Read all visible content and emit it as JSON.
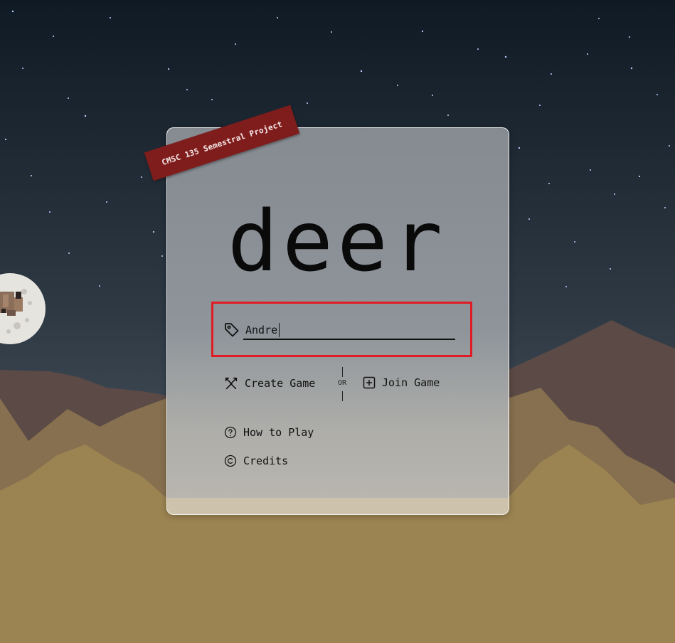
{
  "ribbon": {
    "text": "CMSC 135 Semestral Project"
  },
  "logo": {
    "title": "deer"
  },
  "name_field": {
    "value": "Andre"
  },
  "actions": {
    "create_label": "Create Game",
    "or_label": "OR",
    "join_label": "Join Game",
    "how_to_play_label": "How to Play",
    "credits_label": "Credits"
  },
  "colors": {
    "sky_top": "#0f1a24",
    "sky_bottom": "#5e6670",
    "mountain_back": "#5b4a45",
    "mountain_mid": "#86704f",
    "ground": "#9c8452",
    "ribbon": "#7f1d1d",
    "highlight": "#e01b24"
  },
  "icons": {
    "name": "tag-icon",
    "create": "crossed-swords-icon",
    "join": "plus-square-icon",
    "how_to_play": "question-circle-icon",
    "credits": "copyright-circle-icon"
  }
}
